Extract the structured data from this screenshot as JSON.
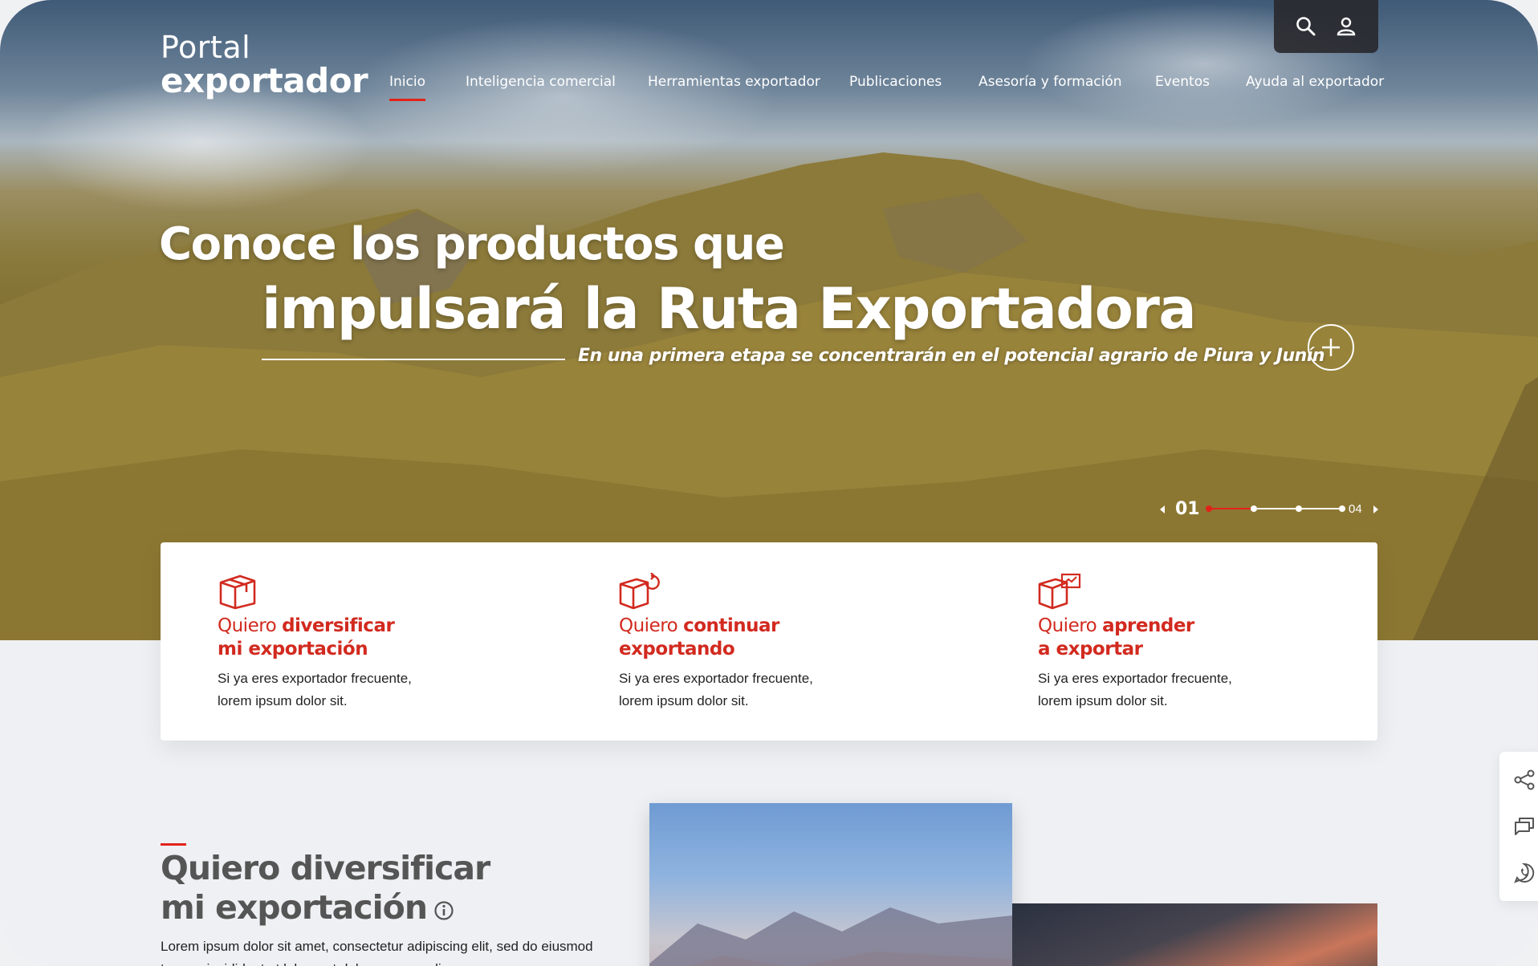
{
  "brand": {
    "line1": "Portal",
    "line2": "exportador"
  },
  "header": {
    "icons": [
      "search-icon",
      "user-icon"
    ]
  },
  "nav": {
    "items": [
      {
        "label": "Inicio",
        "active": true
      },
      {
        "label": "Inteligencia comercial"
      },
      {
        "label": "Herramientas exportador"
      },
      {
        "label": "Publicaciones"
      },
      {
        "label": "Asesoría y formación"
      },
      {
        "label": "Eventos"
      },
      {
        "label": "Ayuda al exportador"
      }
    ],
    "accent": "#e2231a"
  },
  "hero": {
    "title_line1": "Conoce los productos que",
    "title_line2": "impulsará la Ruta Exportadora",
    "subtitle": "En una primera etapa se concentrarán en el potencial agrario de Piura y Junín",
    "slider": {
      "current": "01",
      "total": "04"
    }
  },
  "cards": [
    {
      "icon": "box-icon",
      "title_light": "Quiero ",
      "title_bold": "diversificar",
      "title_line2": "mi exportación",
      "desc1": "Si ya eres exportador frecuente,",
      "desc2": "lorem ipsum dolor sit."
    },
    {
      "icon": "box-refresh-icon",
      "title_light": "Quiero ",
      "title_bold": "continuar",
      "title_line2": "exportando",
      "desc1": "Si ya eres exportador frecuente,",
      "desc2": "lorem ipsum dolor sit."
    },
    {
      "icon": "box-presentation-icon",
      "title_light": "Quiero ",
      "title_bold": "aprender",
      "title_line2": "a exportar",
      "desc1": "Si ya eres exportador frecuente,",
      "desc2": "lorem ipsum dolor sit."
    }
  ],
  "section": {
    "title_line1": "Quiero diversificar",
    "title_line2": "mi exportación",
    "body": "Lorem ipsum dolor sit amet, consectetur adipiscing elit, sed do eiusmod tempor incididunt ut labore et dolore magna aliqua."
  },
  "side_actions": [
    "share-icon",
    "comment-icon",
    "whatsapp-icon"
  ]
}
